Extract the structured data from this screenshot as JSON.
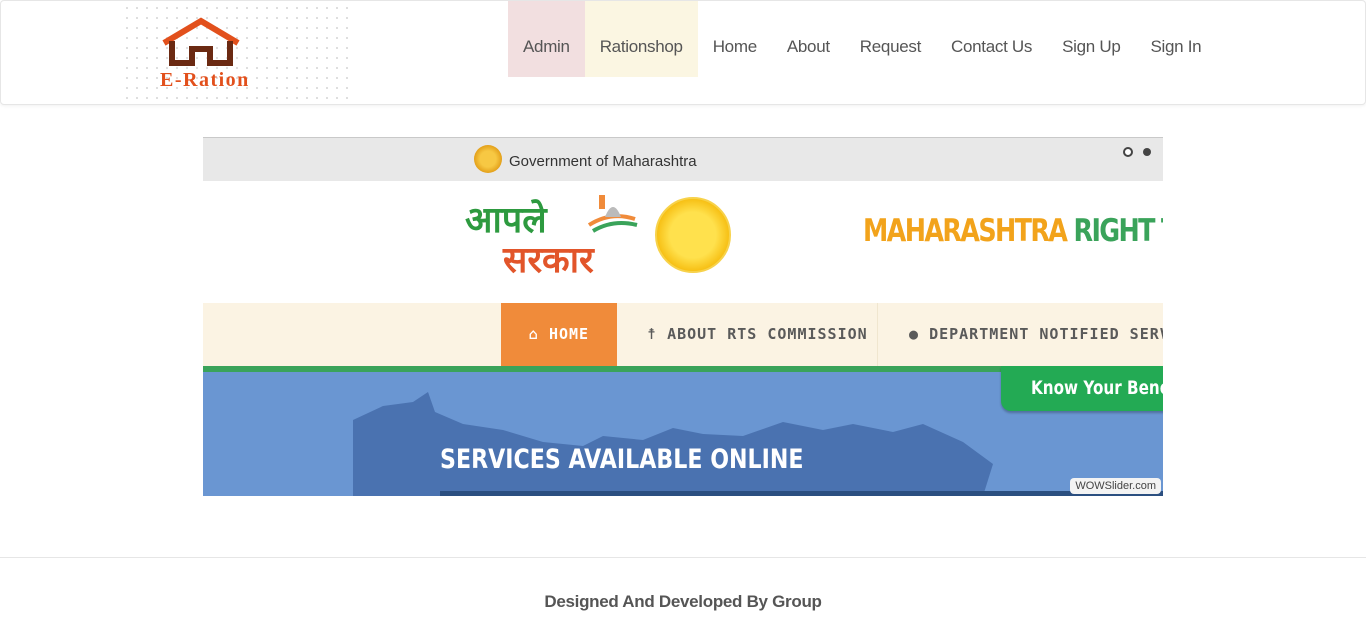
{
  "header": {
    "logo_text": "E-Ration",
    "nav": {
      "admin": "Admin",
      "rationshop": "Rationshop",
      "home": "Home",
      "about": "About",
      "request": "Request",
      "contact": "Contact Us",
      "signup": "Sign Up",
      "signin": "Sign In"
    }
  },
  "slider": {
    "gov_text": "Government of Maharashtra",
    "marathi_line1": "आपले",
    "marathi_line2": "सरकार",
    "rts_title_a": "MAHARASHTRA",
    "rts_title_b": "RIGHT TO",
    "menu": {
      "home": "HOME",
      "about": "ABOUT RTS COMMISSION",
      "dept": "DEPARTMENT NOTIFIED SERVICES"
    },
    "benefit": "Know Your Benefit",
    "services": "SERVICES AVAILABLE ONLINE",
    "watermark": "WOWSlider.com",
    "slide_count": 2,
    "active_slide": 1
  },
  "footer": {
    "text": "Designed And Developed By Group"
  },
  "colors": {
    "accent_orange": "#f08b3a",
    "green": "#3aa35a",
    "logo_orange": "#e2501c"
  }
}
